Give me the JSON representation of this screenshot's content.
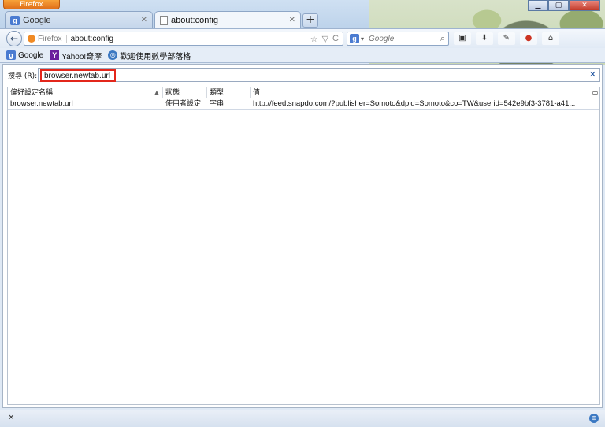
{
  "app": {
    "menu_button": "Firefox"
  },
  "window": {
    "minimize": "▁",
    "maximize": "▢",
    "close": "✕"
  },
  "tabs": [
    {
      "title": "Google",
      "icon": "google-favicon",
      "active": false
    },
    {
      "title": "about:config",
      "icon": "blank-page-favicon",
      "active": true
    }
  ],
  "new_tab": "+",
  "navbar": {
    "back": "←",
    "identity_label": "Firefox",
    "url": "about:config",
    "star": "☆",
    "dropdown": "▽",
    "reload": "C",
    "search_engine": "google-search-icon",
    "search_placeholder": "Google",
    "search_go": "⌕"
  },
  "toolbar_icons": [
    {
      "name": "screenshot-addon-icon",
      "glyph": "▣"
    },
    {
      "name": "download-icon",
      "glyph": "⬇"
    },
    {
      "name": "clip-addon-icon",
      "glyph": "✎"
    },
    {
      "name": "adblock-icon",
      "glyph": "●"
    },
    {
      "name": "home-icon",
      "glyph": "⌂"
    }
  ],
  "bookmarks": [
    {
      "label": "Google",
      "icon": "google-favicon"
    },
    {
      "label": "Yahoo!奇摩",
      "icon": "yahoo-favicon"
    },
    {
      "label": "歡迎使用數學部落格",
      "icon": "globe-favicon"
    }
  ],
  "config": {
    "search_label": "搜尋 (R):",
    "search_value": "browser.newtab.url",
    "clear": "✕",
    "columns": [
      "偏好設定名稱",
      "狀態",
      "類型",
      "值"
    ],
    "rows": [
      {
        "name": "browser.newtab.url",
        "status": "使用者設定",
        "type": "字串",
        "value": "http://feed.snapdo.com/?publisher=Somoto&dpid=Somoto&co=TW&userid=542e9bf3-3781-a41..."
      }
    ]
  },
  "statusbar": {
    "close": "✕",
    "globe": "⊕"
  }
}
